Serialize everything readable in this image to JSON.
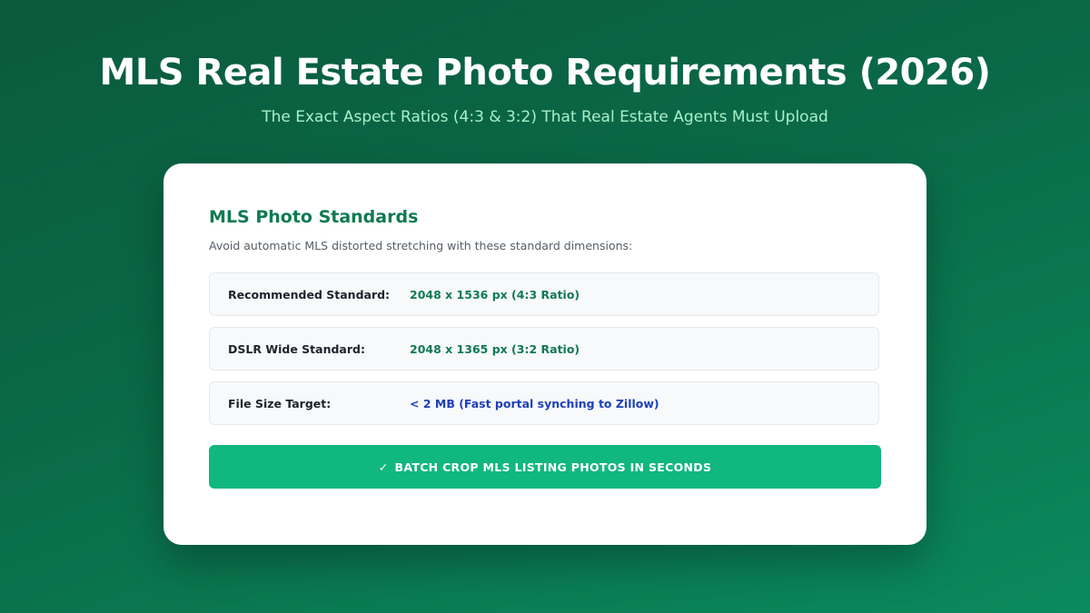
{
  "hero": {
    "title": "MLS Real Estate Photo Requirements (2026)",
    "subtitle": "The Exact Aspect Ratios (4:3 & 3:2) That Real Estate Agents Must Upload"
  },
  "card": {
    "title": "MLS Photo Standards",
    "description": "Avoid automatic MLS distorted stretching with these standard dimensions:",
    "specs": [
      {
        "label": "Recommended Standard:",
        "value": "2048 x 1536 px (4:3 Ratio)",
        "value_color": "#0f7a52"
      },
      {
        "label": "DSLR Wide Standard:",
        "value": "2048 x 1365 px (3:2 Ratio)",
        "value_color": "#0f7a52"
      },
      {
        "label": "File Size Target:",
        "value": "< 2 MB (Fast portal synching to Zillow)",
        "value_color": "#1d3fb8"
      }
    ],
    "cta": {
      "icon": "check-icon",
      "check_glyph": "✓",
      "label": "BATCH CROP MLS LISTING PHOTOS IN SECONDS"
    }
  },
  "colors": {
    "accent_green": "#10b77f",
    "title_green": "#0f7a52",
    "subtitle_mint": "#a8f0c9",
    "link_blue": "#1d3fb8"
  }
}
